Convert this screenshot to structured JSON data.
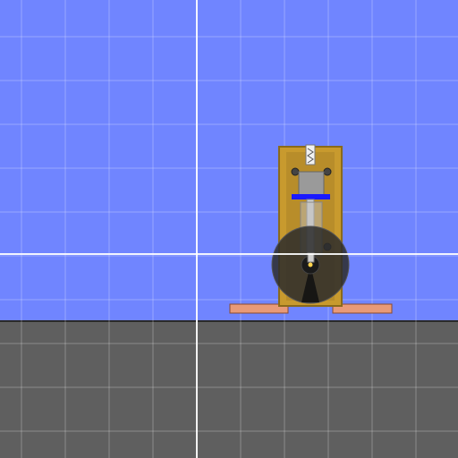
{
  "scene": {
    "sky_color": "#7085ff",
    "ground_color": "#5f5f5f",
    "ground_edge_color": "#2a2a2a",
    "grid_major_color": "rgba(255,255,255,0.28)",
    "grid_minor_color": "rgba(255,255,255,0.10)"
  },
  "machine": {
    "frame_color": "#c89a2e",
    "frame_border_color": "#8a6a1a",
    "cylinder_color": "#9a9a9a",
    "piston_color": "#1a1aff",
    "flywheel_color": "#2b2b2b",
    "foot_color": "#e89a78",
    "foot_border_color": "#8a4a30"
  },
  "cursor": {
    "crosshair_color": "#ffffff"
  }
}
